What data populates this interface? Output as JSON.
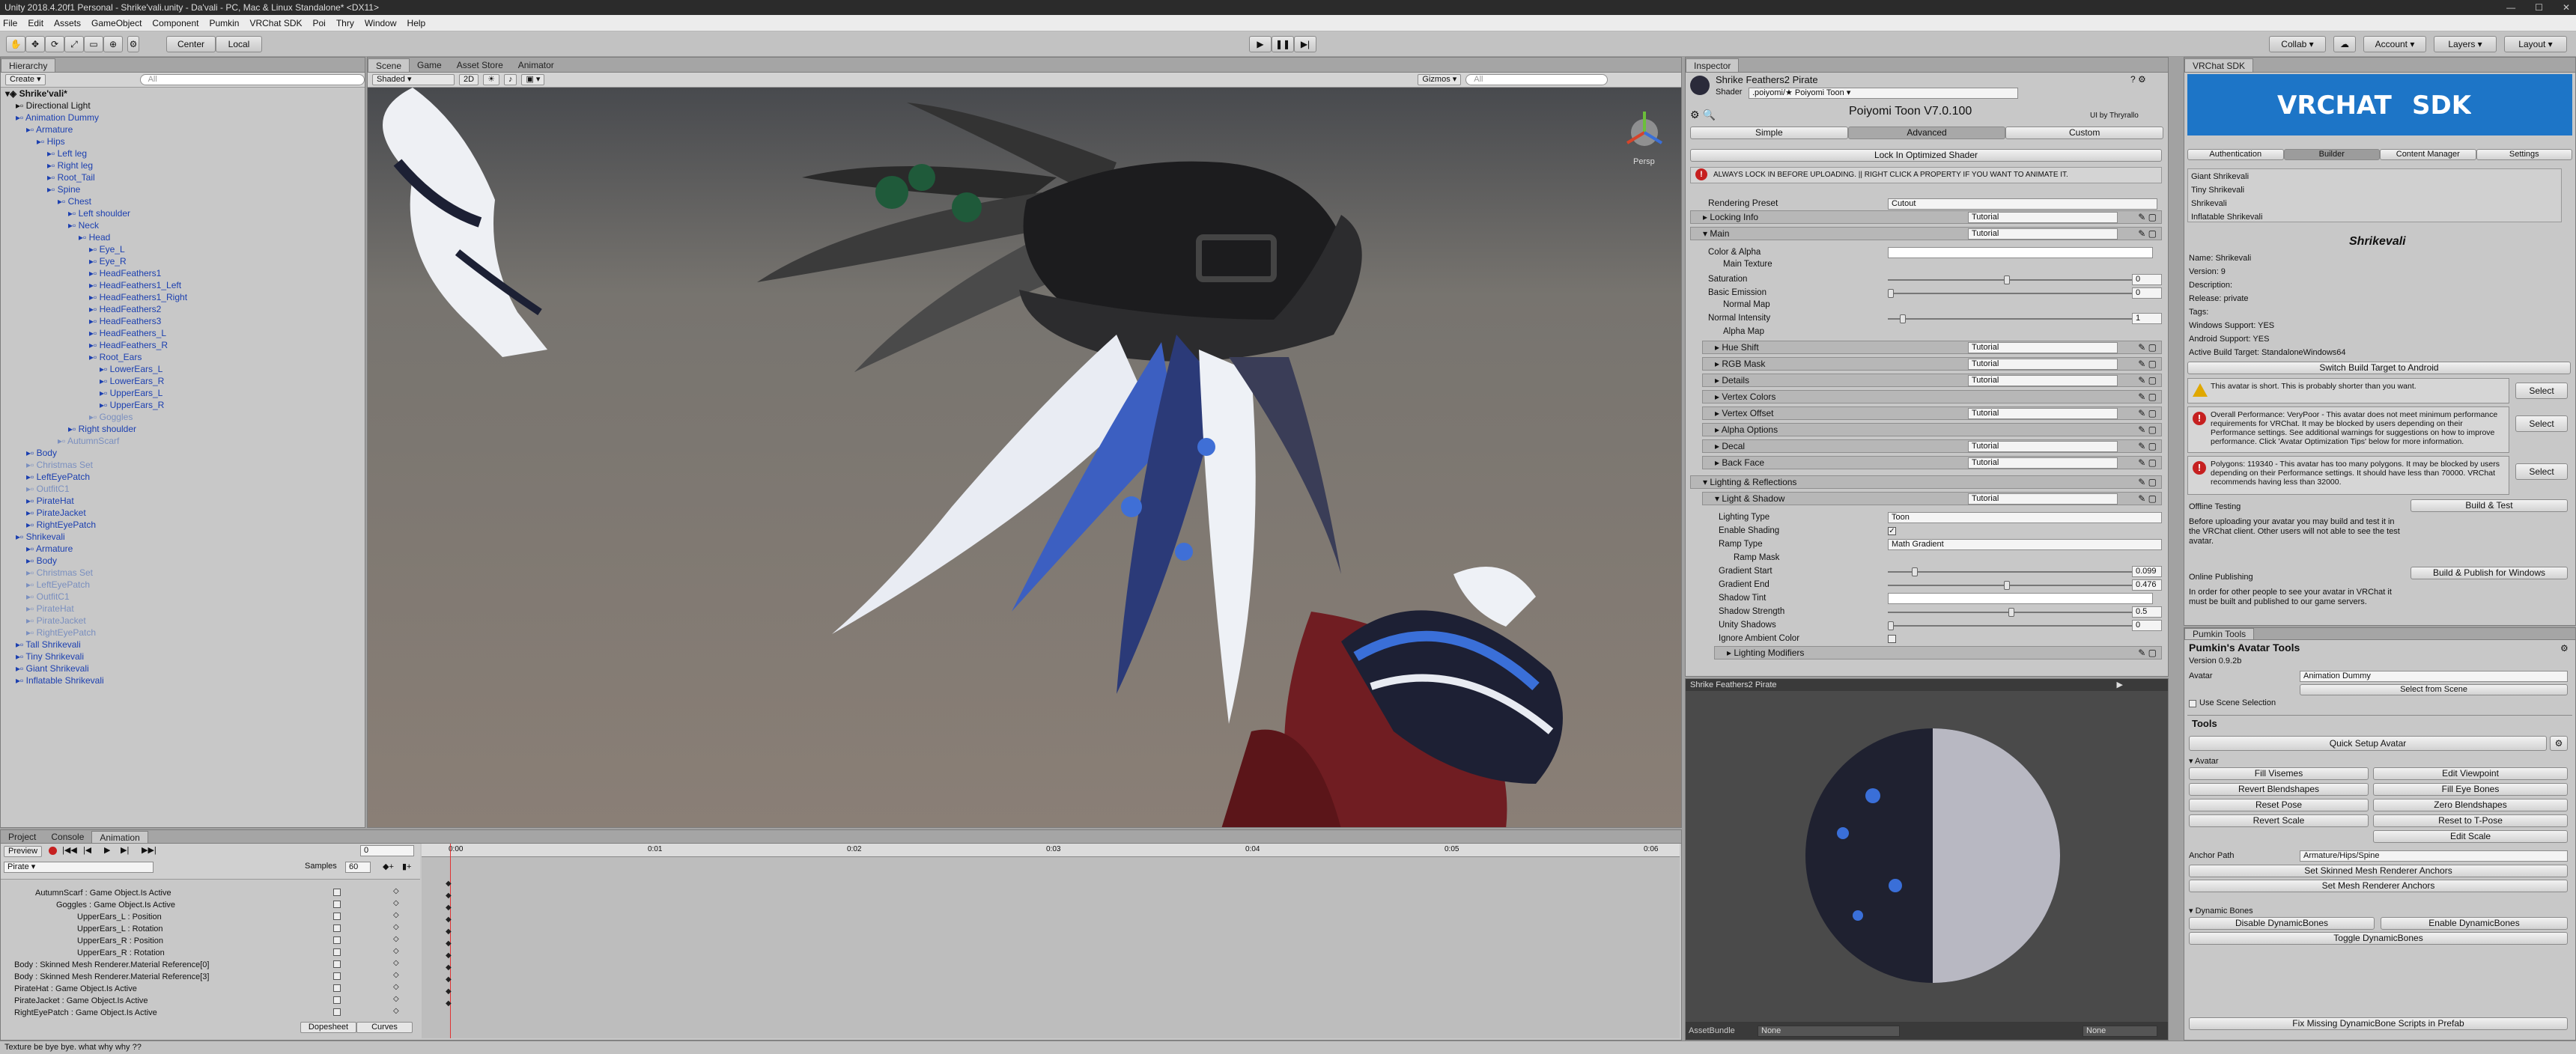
{
  "window": {
    "title": "Unity 2018.4.20f1 Personal - Shrike'vali.unity - Da'vali - PC, Mac & Linux Standalone* <DX11>"
  },
  "menu": [
    "File",
    "Edit",
    "Assets",
    "GameObject",
    "Component",
    "Pumkin",
    "VRChat SDK",
    "Poi",
    "Thry",
    "Window",
    "Help"
  ],
  "toolbar": {
    "center": "Center",
    "local": "Local",
    "collab": "Collab ▾",
    "account": "Account ▾",
    "layers": "Layers ▾",
    "layout": "Layout ▾"
  },
  "hierarchy": {
    "tab": "Hierarchy",
    "create": "Create ▾",
    "search_placeholder": "All",
    "items": [
      {
        "t": "Shrike'vali*",
        "d": 0,
        "s": "root"
      },
      {
        "t": "Directional Light",
        "d": 1,
        "s": "n"
      },
      {
        "t": "Animation Dummy",
        "d": 1,
        "s": "b"
      },
      {
        "t": "Armature",
        "d": 2,
        "s": "b"
      },
      {
        "t": "Hips",
        "d": 3,
        "s": "b"
      },
      {
        "t": "Left leg",
        "d": 4,
        "s": "b"
      },
      {
        "t": "Right leg",
        "d": 4,
        "s": "b"
      },
      {
        "t": "Root_Tail",
        "d": 4,
        "s": "b"
      },
      {
        "t": "Spine",
        "d": 4,
        "s": "b"
      },
      {
        "t": "Chest",
        "d": 5,
        "s": "b"
      },
      {
        "t": "Left shoulder",
        "d": 6,
        "s": "b"
      },
      {
        "t": "Neck",
        "d": 6,
        "s": "b"
      },
      {
        "t": "Head",
        "d": 7,
        "s": "b"
      },
      {
        "t": "Eye_L",
        "d": 8,
        "s": "b"
      },
      {
        "t": "Eye_R",
        "d": 8,
        "s": "b"
      },
      {
        "t": "HeadFeathers1",
        "d": 8,
        "s": "b"
      },
      {
        "t": "HeadFeathers1_Left",
        "d": 8,
        "s": "b"
      },
      {
        "t": "HeadFeathers1_Right",
        "d": 8,
        "s": "b"
      },
      {
        "t": "HeadFeathers2",
        "d": 8,
        "s": "b"
      },
      {
        "t": "HeadFeathers3",
        "d": 8,
        "s": "b"
      },
      {
        "t": "HeadFeathers_L",
        "d": 8,
        "s": "b"
      },
      {
        "t": "HeadFeathers_R",
        "d": 8,
        "s": "b"
      },
      {
        "t": "Root_Ears",
        "d": 8,
        "s": "b"
      },
      {
        "t": "LowerEars_L",
        "d": 9,
        "s": "b"
      },
      {
        "t": "LowerEars_R",
        "d": 9,
        "s": "b"
      },
      {
        "t": "UpperEars_L",
        "d": 9,
        "s": "b"
      },
      {
        "t": "UpperEars_R",
        "d": 9,
        "s": "b"
      },
      {
        "t": "Goggles",
        "d": 8,
        "s": "g"
      },
      {
        "t": "Right shoulder",
        "d": 6,
        "s": "b"
      },
      {
        "t": "AutumnScarf",
        "d": 5,
        "s": "g"
      },
      {
        "t": "Body",
        "d": 2,
        "s": "b"
      },
      {
        "t": "Christmas Set",
        "d": 2,
        "s": "g"
      },
      {
        "t": "LeftEyePatch",
        "d": 2,
        "s": "b"
      },
      {
        "t": "OutfitC1",
        "d": 2,
        "s": "g"
      },
      {
        "t": "PirateHat",
        "d": 2,
        "s": "b"
      },
      {
        "t": "PirateJacket",
        "d": 2,
        "s": "b"
      },
      {
        "t": "RightEyePatch",
        "d": 2,
        "s": "b"
      },
      {
        "t": "Shrikevali",
        "d": 1,
        "s": "b"
      },
      {
        "t": "Armature",
        "d": 2,
        "s": "b"
      },
      {
        "t": "Body",
        "d": 2,
        "s": "b"
      },
      {
        "t": "Christmas Set",
        "d": 2,
        "s": "g"
      },
      {
        "t": "LeftEyePatch",
        "d": 2,
        "s": "g"
      },
      {
        "t": "OutfitC1",
        "d": 2,
        "s": "g"
      },
      {
        "t": "PirateHat",
        "d": 2,
        "s": "g"
      },
      {
        "t": "PirateJacket",
        "d": 2,
        "s": "g"
      },
      {
        "t": "RightEyePatch",
        "d": 2,
        "s": "g"
      },
      {
        "t": "Tall Shrikevali",
        "d": 1,
        "s": "b"
      },
      {
        "t": "Tiny Shrikevali",
        "d": 1,
        "s": "b"
      },
      {
        "t": "Giant Shrikevali",
        "d": 1,
        "s": "b"
      },
      {
        "t": "Inflatable Shrikevali",
        "d": 1,
        "s": "b"
      }
    ]
  },
  "scene": {
    "tabs": [
      "Scene",
      "Game",
      "Asset Store",
      "Animator"
    ],
    "shading": "Shaded",
    "mode_2d": "2D",
    "gizmos": "Gizmos ▾",
    "search_placeholder": "All",
    "persp": "Persp"
  },
  "animation": {
    "tabs": [
      "Project",
      "Console",
      "Animation"
    ],
    "preview": "Preview",
    "frame": "0",
    "clip": "Pirate",
    "samples_label": "Samples",
    "samples": "60",
    "times": [
      "0:00",
      "0:01",
      "0:02",
      "0:03",
      "0:04",
      "0:05",
      "0:06"
    ],
    "props": [
      {
        "t": "AutumnScarf : Game Object.Is Active",
        "ind": 1
      },
      {
        "t": "Goggles : Game Object.Is Active",
        "ind": 2
      },
      {
        "t": "UpperEars_L : Position",
        "ind": 3
      },
      {
        "t": "UpperEars_L : Rotation",
        "ind": 3
      },
      {
        "t": "UpperEars_R : Position",
        "ind": 3
      },
      {
        "t": "UpperEars_R : Rotation",
        "ind": 3
      },
      {
        "t": "Body : Skinned Mesh Renderer.Material Reference[0]",
        "ind": 0
      },
      {
        "t": "Body : Skinned Mesh Renderer.Material Reference[3]",
        "ind": 0
      },
      {
        "t": "PirateHat : Game Object.Is Active",
        "ind": 0
      },
      {
        "t": "PirateJacket : Game Object.Is Active",
        "ind": 0
      },
      {
        "t": "RightEyePatch : Game Object.Is Active",
        "ind": 0
      }
    ],
    "dopesheet": "Dopesheet",
    "curves": "Curves"
  },
  "inspector": {
    "tab": "Inspector",
    "material": "Shrike Feathers2 Pirate",
    "shader_label": "Shader",
    "shader": ".poiyomi/★ Poiyomi Toon",
    "title": "Poiyomi Toon V7.0.100",
    "ui_by": "UI by Thryrallo",
    "modes": [
      "Simple",
      "Advanced",
      "Custom"
    ],
    "lock": "Lock In Optimized Shader",
    "warning": "ALWAYS LOCK IN BEFORE UPLOADING. || RIGHT CLICK A PROPERTY IF YOU WANT TO ANIMATE IT.",
    "rendering_preset_label": "Rendering Preset",
    "rendering_preset": "Cutout",
    "tutorial": "Tutorial",
    "locking_info": "Locking Info",
    "main": "Main",
    "color_alpha": "Color & Alpha",
    "main_texture": "Main Texture",
    "saturation": "Saturation",
    "saturation_val": "0",
    "basic_emission": "Basic Emission",
    "basic_emission_val": "0",
    "normal_map": "Normal Map",
    "normal_intensity": "Normal Intensity",
    "normal_intensity_val": "1",
    "alpha_map": "Alpha Map",
    "sub": [
      "Hue Shift",
      "RGB Mask",
      "Details",
      "Vertex Colors",
      "Vertex Offset",
      "Alpha Options",
      "Decal",
      "Back Face"
    ],
    "lighting": "Lighting & Reflections",
    "light_shadow": "Light & Shadow",
    "lighting_type_label": "Lighting Type",
    "lighting_type": "Toon",
    "enable_shading": "Enable Shading",
    "ramp_type_label": "Ramp Type",
    "ramp_type": "Math Gradient",
    "ramp_mask": "Ramp Mask",
    "gradient_start": "Gradient Start",
    "gradient_start_val": "0.099",
    "gradient_end": "Gradient End",
    "gradient_end_val": "0.476",
    "shadow_tint": "Shadow Tint",
    "shadow_strength": "Shadow Strength",
    "shadow_strength_val": "0.5",
    "unity_shadows": "Unity Shadows",
    "unity_shadows_val": "0",
    "ignore_ambient": "Ignore Ambient Color",
    "lighting_modifiers": "Lighting Modifiers",
    "preview_title": "Shrike Feathers2 Pirate",
    "asset_bundle": "AssetBundle",
    "none1": "None",
    "none2": "None"
  },
  "vrchat": {
    "tab": "VRChat SDK",
    "logo": "VRCHAT",
    "logo_sdk": "SDK",
    "tabs": [
      "Authentication",
      "Builder",
      "Content Manager",
      "Settings"
    ],
    "avatars": [
      "Giant Shrikevali",
      "Tiny Shrikevali",
      "Shrikevali",
      "Inflatable Shrikevali"
    ],
    "selected_name": "Shrikevali",
    "info": [
      "Name: Shrikevali",
      "Version: 9",
      "Description:",
      "Release: private",
      "Tags:",
      "Windows Support: YES",
      "Android Support: YES",
      "Active Build Target: StandaloneWindows64"
    ],
    "switch_target": "Switch Build Target to Android",
    "warnings": [
      "This avatar is short. This is probably shorter than you want.",
      "Overall Performance: VeryPoor - This avatar does not meet minimum performance requirements for VRChat. It may be blocked by users depending on their Performance settings. See additional warnings for suggestions on how to improve performance. Click 'Avatar Optimization Tips' below for more information.",
      "Polygons: 119340 - This avatar has too many polygons. It may be blocked by users depending on their Performance settings. It should have less than 70000. VRChat recommends having less than 32000."
    ],
    "select": "Select",
    "offline_title": "Offline Testing",
    "build_test": "Build & Test",
    "offline_text": "Before uploading your avatar you may build and test it in the VRChat client. Other users will not able to see the test avatar.",
    "online_title": "Online Publishing",
    "build_publish": "Build & Publish for Windows",
    "online_text": "In order for other people to see your avatar in VRChat it must be built and published to our game servers."
  },
  "pumkin": {
    "tab": "Pumkin Tools",
    "title": "Pumkin's Avatar Tools",
    "version": "Version 0.9.2b",
    "avatar_label": "Avatar",
    "avatar": "Animation Dummy",
    "select_scene": "Select from Scene",
    "use_scene": "Use Scene Selection",
    "tools": "Tools",
    "quick_setup": "Quick Setup Avatar",
    "avatar_section": "Avatar",
    "left_btns": [
      "Fill Visemes",
      "Revert Blendshapes",
      "Reset Pose",
      "Revert Scale"
    ],
    "right_btns": [
      "Edit Viewpoint",
      "Fill Eye Bones",
      "Zero Blendshapes",
      "Reset to T-Pose",
      "Edit Scale"
    ],
    "anchor_label": "Anchor Path",
    "anchor": "Armature/Hips/Spine",
    "set_skinned": "Set Skinned Mesh Renderer Anchors",
    "set_mesh": "Set Mesh Renderer Anchors",
    "dynbones": "Dynamic Bones",
    "disable_db": "Disable DynamicBones",
    "enable_db": "Enable DynamicBones",
    "toggle_db": "Toggle DynamicBones",
    "fix_missing": "Fix Missing DynamicBone Scripts in Prefab"
  },
  "status": {
    "text": "Texture be bye bye. what why why ??"
  },
  "colors": {
    "accent_blue": "#3a6fd8",
    "vrchat_blue": "#1d75c7",
    "error": "#c62020",
    "warning": "#e0a800"
  }
}
